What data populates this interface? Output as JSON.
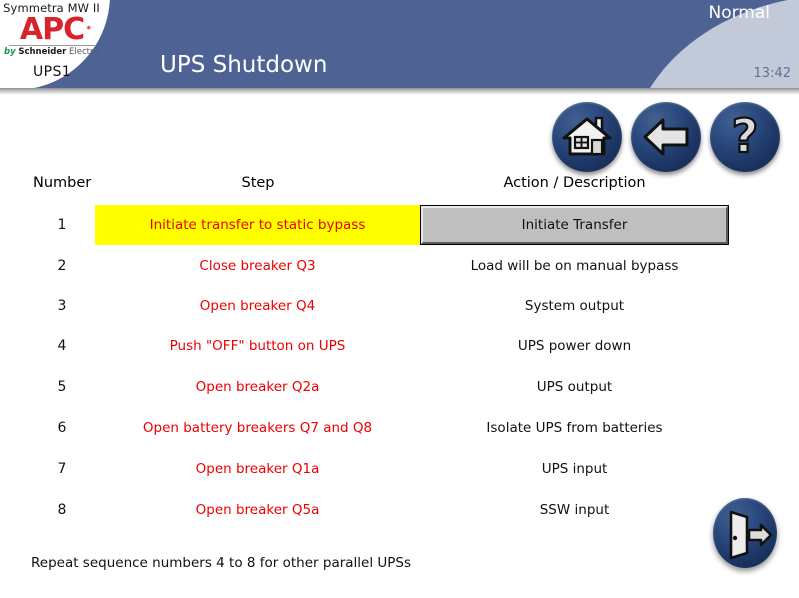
{
  "header": {
    "logo": {
      "product": "Symmetra MW II",
      "brand": "APC",
      "brand_mark": "*",
      "by": "by",
      "company": "Schneider",
      "company_suffix": "Electric",
      "unit": "UPS1"
    },
    "title": "UPS Shutdown",
    "status": "Normal",
    "time": "13:42",
    "colors": {
      "band_blue": "#4f6294",
      "panel_light": "#c2cada",
      "title_text": "#ffffff",
      "clock_text": "#5f7193"
    }
  },
  "nav": {
    "buttons": [
      {
        "name": "home-button",
        "icon": "home-icon",
        "label": "Home"
      },
      {
        "name": "back-button",
        "icon": "back-arrow-icon",
        "label": "Back"
      },
      {
        "name": "help-button",
        "icon": "question-mark-icon",
        "label": "Help"
      }
    ],
    "exit": {
      "name": "exit-button",
      "icon": "exit-door-icon",
      "label": "Exit"
    }
  },
  "table": {
    "columns": [
      "Number",
      "Step",
      "Action / Description"
    ],
    "rows": [
      {
        "number": "1",
        "step": "Initiate transfer to static bypass",
        "action": "Initiate Transfer",
        "highlight": true,
        "action_is_button": true
      },
      {
        "number": "2",
        "step": "Close breaker Q3",
        "action": "Load will be on manual bypass",
        "highlight": false,
        "action_is_button": false
      },
      {
        "number": "3",
        "step": "Open breaker Q4",
        "action": "System output",
        "highlight": false,
        "action_is_button": false
      },
      {
        "number": "4",
        "step": "Push \"OFF\" button on UPS",
        "action": "UPS power down",
        "highlight": false,
        "action_is_button": false
      },
      {
        "number": "5",
        "step": "Open breaker Q2a",
        "action": "UPS output",
        "highlight": false,
        "action_is_button": false
      },
      {
        "number": "6",
        "step": "Open battery breakers Q7 and Q8",
        "action": "Isolate UPS from batteries",
        "highlight": false,
        "action_is_button": false
      },
      {
        "number": "7",
        "step": "Open breaker Q1a",
        "action": "UPS input",
        "highlight": false,
        "action_is_button": false
      },
      {
        "number": "8",
        "step": "Open breaker Q5a",
        "action": "SSW input",
        "highlight": false,
        "action_is_button": false
      }
    ],
    "highlight_color": "#ffff00",
    "step_text_color": "#ee0000"
  },
  "footer": {
    "note": "Repeat sequence numbers 4 to 8 for other parallel UPSs"
  }
}
